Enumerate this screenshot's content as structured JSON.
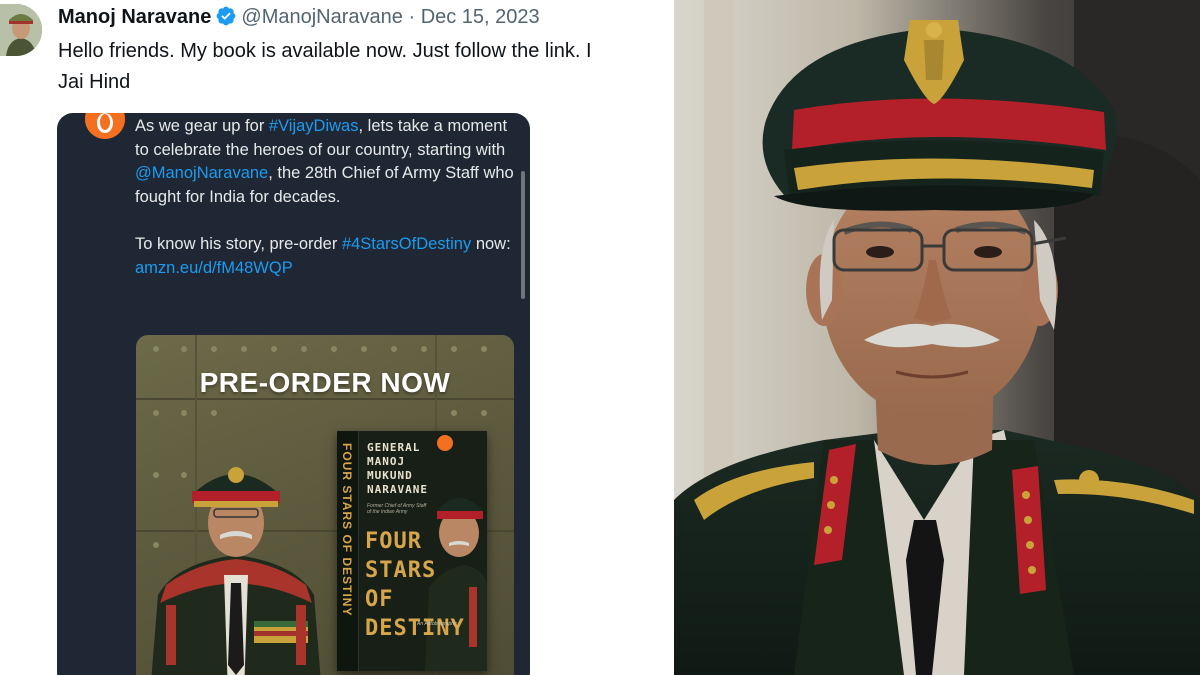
{
  "tweet": {
    "author_name": "Manoj Naravane",
    "handle": "@ManojNaravane",
    "separator": "·",
    "date": "Dec 15, 2023",
    "text_line_1": "Hello friends. My book is available now. Just follow the link. I",
    "text_line_2": "Jai Hind"
  },
  "embedded_post": {
    "p1_before_tag": "As we gear up for ",
    "p1_hashtag": "#VijayDiwas",
    "p1_middle": ", lets take a moment to celebrate the heroes of our country, starting with ",
    "p1_mention": "@ManojNaravane",
    "p1_after": ", the 28th Chief of Army Staff who fought for India for decades.",
    "p2_before": "To know his story, pre-order ",
    "p2_hashtag": "#4StarsOfDestiny",
    "p2_after": " now:",
    "p2_link": "amzn.eu/d/fM48WQP"
  },
  "poster": {
    "headline": "PRE-ORDER NOW",
    "book_spine": "FOUR STARS OF DESTINY",
    "book_author_1": "GENERAL",
    "book_author_2": "MANOJ",
    "book_author_3": "MUKUND",
    "book_author_4": "NARAVANE",
    "book_subtitle": "Former Chief of Army Staff of the Indian Army",
    "book_title_1": "FOUR",
    "book_title_2": "STARS",
    "book_title_3": "OF",
    "book_title_4": "DESTINY",
    "book_tagline": "An Autobiography"
  },
  "colors": {
    "link_blue": "#1d9bf0",
    "card_bg": "#1e2733",
    "verified_blue": "#1d9bf0",
    "penguin_orange": "#f37021",
    "cap_red": "#b3202a",
    "gold": "#c9a23a"
  },
  "icons": {
    "verified": "verified-badge-icon",
    "publisher": "penguin-logo-icon"
  }
}
